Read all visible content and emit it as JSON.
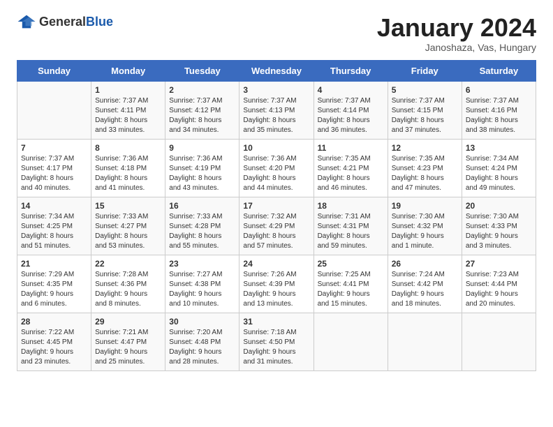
{
  "header": {
    "logo_general": "General",
    "logo_blue": "Blue",
    "month_title": "January 2024",
    "subtitle": "Janoshaza, Vas, Hungary"
  },
  "weekdays": [
    "Sunday",
    "Monday",
    "Tuesday",
    "Wednesday",
    "Thursday",
    "Friday",
    "Saturday"
  ],
  "weeks": [
    [
      {
        "day": "",
        "info": ""
      },
      {
        "day": "1",
        "info": "Sunrise: 7:37 AM\nSunset: 4:11 PM\nDaylight: 8 hours\nand 33 minutes."
      },
      {
        "day": "2",
        "info": "Sunrise: 7:37 AM\nSunset: 4:12 PM\nDaylight: 8 hours\nand 34 minutes."
      },
      {
        "day": "3",
        "info": "Sunrise: 7:37 AM\nSunset: 4:13 PM\nDaylight: 8 hours\nand 35 minutes."
      },
      {
        "day": "4",
        "info": "Sunrise: 7:37 AM\nSunset: 4:14 PM\nDaylight: 8 hours\nand 36 minutes."
      },
      {
        "day": "5",
        "info": "Sunrise: 7:37 AM\nSunset: 4:15 PM\nDaylight: 8 hours\nand 37 minutes."
      },
      {
        "day": "6",
        "info": "Sunrise: 7:37 AM\nSunset: 4:16 PM\nDaylight: 8 hours\nand 38 minutes."
      }
    ],
    [
      {
        "day": "7",
        "info": "Sunrise: 7:37 AM\nSunset: 4:17 PM\nDaylight: 8 hours\nand 40 minutes."
      },
      {
        "day": "8",
        "info": "Sunrise: 7:36 AM\nSunset: 4:18 PM\nDaylight: 8 hours\nand 41 minutes."
      },
      {
        "day": "9",
        "info": "Sunrise: 7:36 AM\nSunset: 4:19 PM\nDaylight: 8 hours\nand 43 minutes."
      },
      {
        "day": "10",
        "info": "Sunrise: 7:36 AM\nSunset: 4:20 PM\nDaylight: 8 hours\nand 44 minutes."
      },
      {
        "day": "11",
        "info": "Sunrise: 7:35 AM\nSunset: 4:21 PM\nDaylight: 8 hours\nand 46 minutes."
      },
      {
        "day": "12",
        "info": "Sunrise: 7:35 AM\nSunset: 4:23 PM\nDaylight: 8 hours\nand 47 minutes."
      },
      {
        "day": "13",
        "info": "Sunrise: 7:34 AM\nSunset: 4:24 PM\nDaylight: 8 hours\nand 49 minutes."
      }
    ],
    [
      {
        "day": "14",
        "info": "Sunrise: 7:34 AM\nSunset: 4:25 PM\nDaylight: 8 hours\nand 51 minutes."
      },
      {
        "day": "15",
        "info": "Sunrise: 7:33 AM\nSunset: 4:27 PM\nDaylight: 8 hours\nand 53 minutes."
      },
      {
        "day": "16",
        "info": "Sunrise: 7:33 AM\nSunset: 4:28 PM\nDaylight: 8 hours\nand 55 minutes."
      },
      {
        "day": "17",
        "info": "Sunrise: 7:32 AM\nSunset: 4:29 PM\nDaylight: 8 hours\nand 57 minutes."
      },
      {
        "day": "18",
        "info": "Sunrise: 7:31 AM\nSunset: 4:31 PM\nDaylight: 8 hours\nand 59 minutes."
      },
      {
        "day": "19",
        "info": "Sunrise: 7:30 AM\nSunset: 4:32 PM\nDaylight: 9 hours\nand 1 minute."
      },
      {
        "day": "20",
        "info": "Sunrise: 7:30 AM\nSunset: 4:33 PM\nDaylight: 9 hours\nand 3 minutes."
      }
    ],
    [
      {
        "day": "21",
        "info": "Sunrise: 7:29 AM\nSunset: 4:35 PM\nDaylight: 9 hours\nand 6 minutes."
      },
      {
        "day": "22",
        "info": "Sunrise: 7:28 AM\nSunset: 4:36 PM\nDaylight: 9 hours\nand 8 minutes."
      },
      {
        "day": "23",
        "info": "Sunrise: 7:27 AM\nSunset: 4:38 PM\nDaylight: 9 hours\nand 10 minutes."
      },
      {
        "day": "24",
        "info": "Sunrise: 7:26 AM\nSunset: 4:39 PM\nDaylight: 9 hours\nand 13 minutes."
      },
      {
        "day": "25",
        "info": "Sunrise: 7:25 AM\nSunset: 4:41 PM\nDaylight: 9 hours\nand 15 minutes."
      },
      {
        "day": "26",
        "info": "Sunrise: 7:24 AM\nSunset: 4:42 PM\nDaylight: 9 hours\nand 18 minutes."
      },
      {
        "day": "27",
        "info": "Sunrise: 7:23 AM\nSunset: 4:44 PM\nDaylight: 9 hours\nand 20 minutes."
      }
    ],
    [
      {
        "day": "28",
        "info": "Sunrise: 7:22 AM\nSunset: 4:45 PM\nDaylight: 9 hours\nand 23 minutes."
      },
      {
        "day": "29",
        "info": "Sunrise: 7:21 AM\nSunset: 4:47 PM\nDaylight: 9 hours\nand 25 minutes."
      },
      {
        "day": "30",
        "info": "Sunrise: 7:20 AM\nSunset: 4:48 PM\nDaylight: 9 hours\nand 28 minutes."
      },
      {
        "day": "31",
        "info": "Sunrise: 7:18 AM\nSunset: 4:50 PM\nDaylight: 9 hours\nand 31 minutes."
      },
      {
        "day": "",
        "info": ""
      },
      {
        "day": "",
        "info": ""
      },
      {
        "day": "",
        "info": ""
      }
    ]
  ]
}
